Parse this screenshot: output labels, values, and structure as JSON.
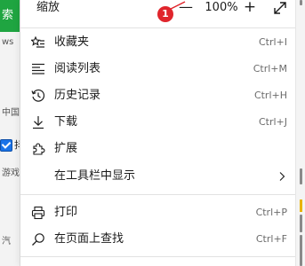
{
  "background": {
    "green_char": "索",
    "fragments": [
      "ws",
      "中国",
      "游戏",
      "汽"
    ],
    "check_text": "抖"
  },
  "zoom": {
    "label": "缩放",
    "minus": "—",
    "value": "100%",
    "plus": "+",
    "badge": "1"
  },
  "menu_items": [
    {
      "label": "收藏夹",
      "shortcut": "Ctrl+I",
      "icon": "favorites-star-icon"
    },
    {
      "label": "阅读列表",
      "shortcut": "Ctrl+M",
      "icon": "reading-list-icon"
    },
    {
      "label": "历史记录",
      "shortcut": "Ctrl+H",
      "icon": "history-icon"
    },
    {
      "label": "下载",
      "shortcut": "Ctrl+J",
      "icon": "download-icon"
    },
    {
      "label": "扩展",
      "shortcut": "",
      "icon": "extensions-icon"
    },
    {
      "label": "在工具栏中显示",
      "shortcut": "",
      "icon": ""
    },
    {
      "label": "打印",
      "shortcut": "Ctrl+P",
      "icon": "print-icon"
    },
    {
      "label": "在页面上查找",
      "shortcut": "Ctrl+F",
      "icon": "find-icon"
    }
  ],
  "colors": {
    "accent_green": "#1fa541",
    "badge_red": "#e0252c"
  }
}
